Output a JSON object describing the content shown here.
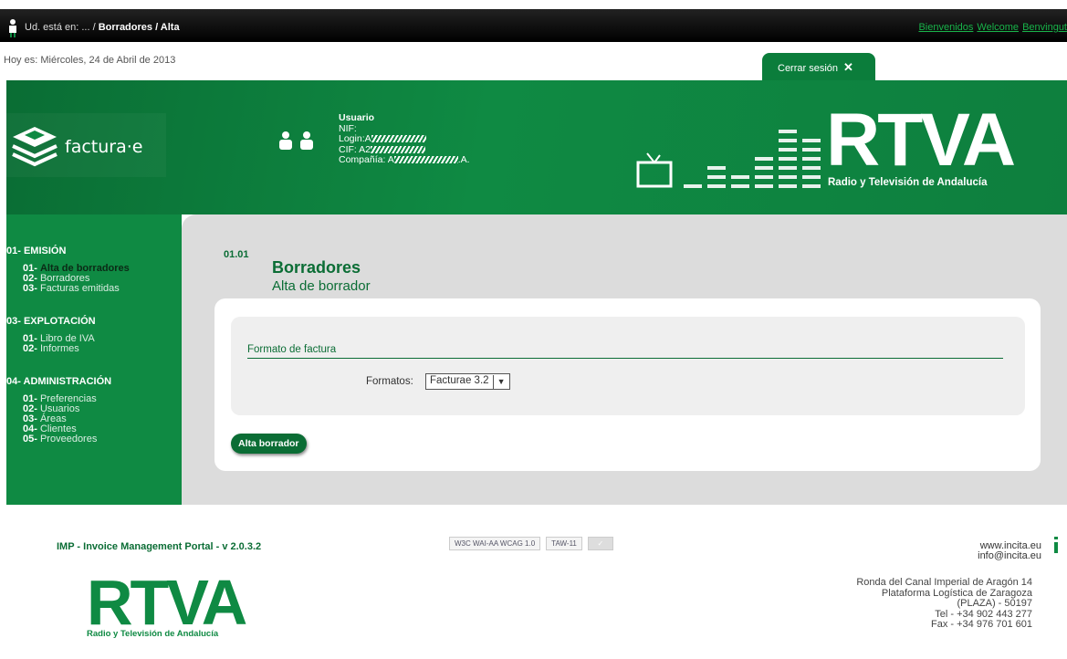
{
  "topbar": {
    "breadcrumb_prefix": "Ud. está en: ... / ",
    "breadcrumb_section": "Borradores",
    "breadcrumb_sep": " / ",
    "breadcrumb_current": "Alta",
    "langs": [
      "Bienvenidos",
      "Welcome",
      "Benvingut"
    ]
  },
  "date_text": "Hoy es: Miércoles, 24 de Abril de 2013",
  "logout_label": "Cerrar sesión",
  "banner": {
    "facturae": "factura·e",
    "user": {
      "title": "Usuario",
      "nif": "NIF:",
      "login": "Login:A",
      "cif": "CIF: A2",
      "company": "Compañía: A",
      "company_suffix": ".A."
    },
    "brand": "RTVA",
    "brand_sub": "Radio y Televisión de Andalucía"
  },
  "sidebar": [
    {
      "title": "01- EMISIÓN",
      "items": [
        {
          "num": "01-",
          "label": "Alta de borradores",
          "active": true
        },
        {
          "num": "02-",
          "label": "Borradores"
        },
        {
          "num": "03-",
          "label": "Facturas emitidas"
        }
      ]
    },
    {
      "title": "03- EXPLOTACIÓN",
      "items": [
        {
          "num": "01-",
          "label": "Libro de IVA"
        },
        {
          "num": "02-",
          "label": "Informes"
        }
      ]
    },
    {
      "title": "04- ADMINISTRACIÓN",
      "items": [
        {
          "num": "01-",
          "label": "Preferencias"
        },
        {
          "num": "02-",
          "label": "Usuarios"
        },
        {
          "num": "03-",
          "label": "Áreas"
        },
        {
          "num": "04-",
          "label": "Clientes"
        },
        {
          "num": "05-",
          "label": "Proveedores"
        }
      ]
    }
  ],
  "main": {
    "code": "01.01",
    "title": "Borradores",
    "subtitle": "Alta de borrador",
    "fieldset_legend": "Formato de factura",
    "formats_label": "Formatos:",
    "formats_value": "Facturae 3.2",
    "submit_label": "Alta borrador"
  },
  "footer": {
    "version": "IMP - Invoice Management Portal - v 2.0.3.2",
    "badges": [
      "W3C WAI-AA WCAG 1.0",
      "TAW-11"
    ],
    "web": "www.incita.eu",
    "email": "info@incita.eu",
    "address": [
      "Ronda del Canal Imperial de Aragón 14",
      "Plataforma Logística de Zaragoza",
      "(PLAZA) - 50197",
      "Tel - +34 902 443 277",
      "Fax - +34 976 701 601"
    ],
    "brand": "RTVA",
    "brand_sub": "Radio y Televisión de Andalucía"
  },
  "colors": {
    "brand_green": "#0f8a43",
    "dark_green": "#0b6d35",
    "link_green": "#19b34a"
  }
}
